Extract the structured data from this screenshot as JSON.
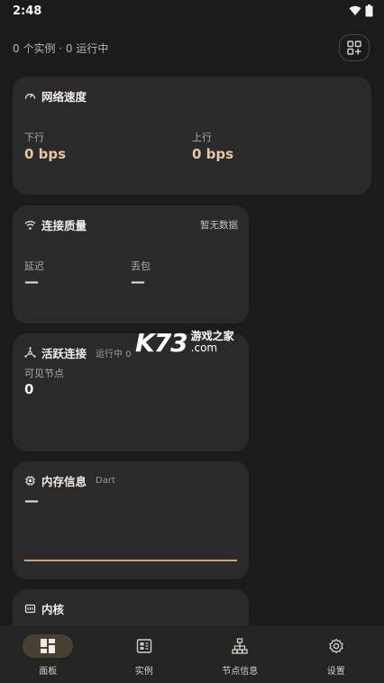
{
  "status_bar": {
    "time": "2:48"
  },
  "summary": {
    "text": "0 个实例 · 0 运行中"
  },
  "network_speed": {
    "title": "网络速度",
    "download_label": "下行",
    "download_value": "0 bps",
    "upload_label": "上行",
    "upload_value": "0 bps"
  },
  "connection_quality": {
    "title": "连接质量",
    "tag": "暂无数据",
    "latency_label": "延迟",
    "latency_value": "—",
    "loss_label": "丢包",
    "loss_value": "—"
  },
  "active_connections": {
    "title": "活跃连接",
    "subtitle": "运行中 0",
    "visible_nodes_label": "可见节点",
    "visible_nodes_value": "0"
  },
  "memory": {
    "title": "内存信息",
    "subtitle": "Dart",
    "value": "—"
  },
  "kernel": {
    "title": "内核"
  },
  "watermark": {
    "brand": "K73",
    "cn": "游戏之家",
    "domain": ".com"
  },
  "nav": {
    "items": [
      {
        "label": "面板",
        "icon": "dashboard-icon",
        "active": true
      },
      {
        "label": "实例",
        "icon": "instance-icon",
        "active": false
      },
      {
        "label": "节点信息",
        "icon": "network-tree-icon",
        "active": false
      },
      {
        "label": "设置",
        "icon": "gear-icon",
        "active": false
      }
    ]
  },
  "colors": {
    "background": "#1b1b1b",
    "card": "#2a2a2a",
    "accent": "#e6c6a3",
    "active_pill": "#4a3f33"
  }
}
